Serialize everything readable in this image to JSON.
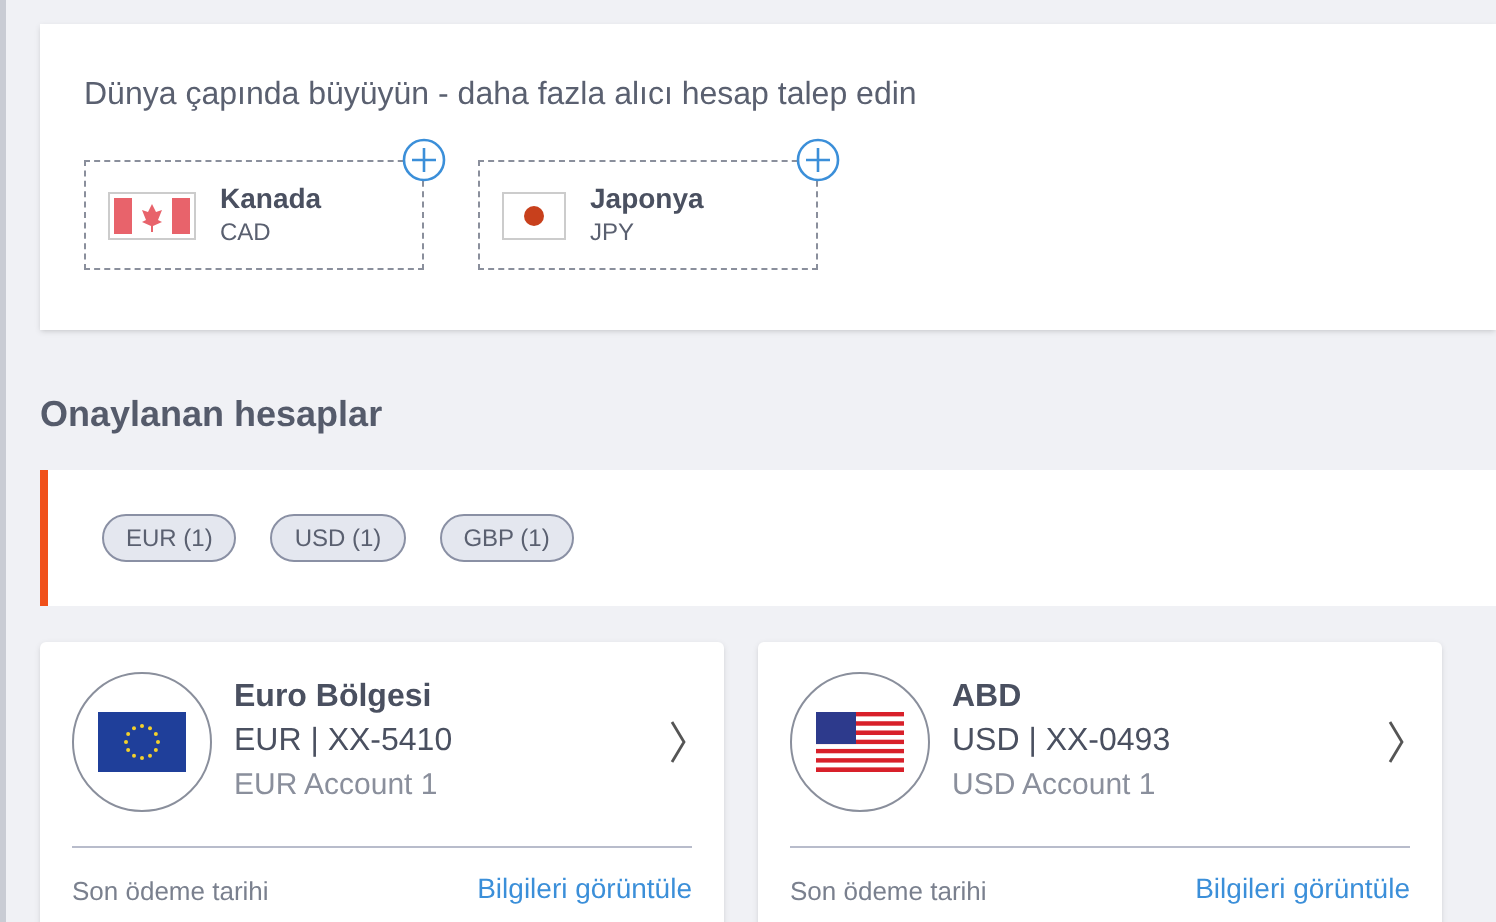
{
  "promo": {
    "heading": "Dünya çapında büyüyün - daha fazla alıcı hesap talep edin",
    "options": [
      {
        "kind": "ca",
        "name": "Kanada",
        "code": "CAD"
      },
      {
        "kind": "jp",
        "name": "Japonya",
        "code": "JPY"
      }
    ]
  },
  "approved": {
    "title": "Onaylanan hesaplar",
    "filters": [
      {
        "label": "EUR (1)"
      },
      {
        "label": "USD (1)"
      },
      {
        "label": "GBP (1)"
      }
    ],
    "accounts": [
      {
        "kind": "eu",
        "region": "Euro Bölgesi",
        "number": "EUR | XX-5410",
        "nickname": "EUR Account 1",
        "due_label": "Son ödeme tarihi",
        "link": "Bilgileri görüntüle"
      },
      {
        "kind": "us",
        "region": "ABD",
        "number": "USD | XX-0493",
        "nickname": "USD Account 1",
        "due_label": "Son ödeme tarihi",
        "link": "Bilgileri görüntüle"
      }
    ]
  }
}
